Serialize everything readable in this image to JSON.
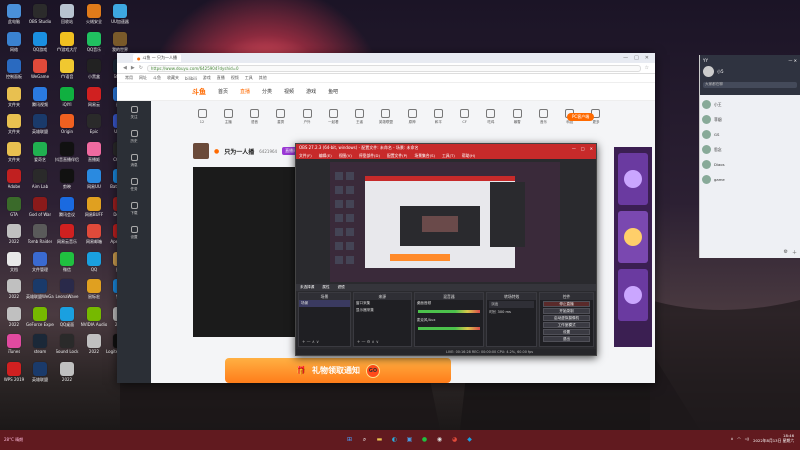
{
  "desktop": {
    "icons": [
      {
        "label": "此电脑",
        "color": "#4a90d9"
      },
      {
        "label": "OBS Studio",
        "color": "#2b2b2b"
      },
      {
        "label": "回收站",
        "color": "#b8c4d0"
      },
      {
        "label": "火绒安全",
        "color": "#e07b1a"
      },
      {
        "label": "UU加速器",
        "color": "#3da8e0"
      },
      {
        "label": "网络",
        "color": "#3a82d0"
      },
      {
        "label": "QQ游戏",
        "color": "#1a8fe0"
      },
      {
        "label": "YY游戏大厅",
        "color": "#f0c020"
      },
      {
        "label": "QQ音乐",
        "color": "#20c060"
      },
      {
        "label": "我的世界",
        "color": "#7a5a2a"
      },
      {
        "label": "控制面板",
        "color": "#2a6ac0"
      },
      {
        "label": "WeGame",
        "color": "#e04a3a"
      },
      {
        "label": "YY语音",
        "color": "#f0c830"
      },
      {
        "label": "小黑盒",
        "color": "#222222"
      },
      {
        "label": "Steam",
        "color": "#1b2838"
      },
      {
        "label": "文件夹",
        "color": "#e8c050"
      },
      {
        "label": "腾讯视频",
        "color": "#2a7ae0"
      },
      {
        "label": "iQIYI",
        "color": "#10b040"
      },
      {
        "label": "网易云",
        "color": "#d02020"
      },
      {
        "label": "迅雷",
        "color": "#2a7ae0"
      },
      {
        "label": "文件夹",
        "color": "#e8c050"
      },
      {
        "label": "英雄联盟",
        "color": "#1a3a6a"
      },
      {
        "label": "Origin",
        "color": "#f06020"
      },
      {
        "label": "Epic",
        "color": "#2a2a2a"
      },
      {
        "label": "Uplay",
        "color": "#3a5ad0"
      },
      {
        "label": "文件夹",
        "color": "#e8c050"
      },
      {
        "label": "爱奇艺",
        "color": "#20b050"
      },
      {
        "label": "抖音直播伴侣",
        "color": "#111111"
      },
      {
        "label": "直播姬",
        "color": "#f06aa0"
      },
      {
        "label": "CC直播",
        "color": "#2a2a2a"
      },
      {
        "label": "Adobe",
        "color": "#c02020"
      },
      {
        "label": "Aim Lab",
        "color": "#2a2a2a"
      },
      {
        "label": "剪映",
        "color": "#111111"
      },
      {
        "label": "网易UU",
        "color": "#2a8ae0"
      },
      {
        "label": "Battle.net",
        "color": "#1a8ae0"
      },
      {
        "label": "GTA",
        "color": "#3a6a2a"
      },
      {
        "label": "God of War",
        "color": "#8a1a1a"
      },
      {
        "label": "腾讯会议",
        "color": "#1a6ae0"
      },
      {
        "label": "网易BUFF",
        "color": "#e0a020"
      },
      {
        "label": "Dota 2",
        "color": "#a02020"
      },
      {
        "label": "2022",
        "color": "#c0c0c0"
      },
      {
        "label": "Tomb Raider",
        "color": "#5a5a5a"
      },
      {
        "label": "网易云音乐",
        "color": "#d02020"
      },
      {
        "label": "网易邮箱",
        "color": "#e04a3a"
      },
      {
        "label": "Apex 英雄",
        "color": "#c02020"
      },
      {
        "label": "文档",
        "color": "#e8e8e8"
      },
      {
        "label": "文件管理",
        "color": "#3a6ad0"
      },
      {
        "label": "微信",
        "color": "#20c040"
      },
      {
        "label": "QQ",
        "color": "#1aa0e0"
      },
      {
        "label": "图片",
        "color": "#d0a050"
      },
      {
        "label": "2022",
        "color": "#c0c0c0"
      },
      {
        "label": "英雄联盟WeGame",
        "color": "#1a3a6a"
      },
      {
        "label": "LeonaWave",
        "color": "#2a2a4a"
      },
      {
        "label": "鼠标宏",
        "color": "#e0a020"
      },
      {
        "label": "钉钉",
        "color": "#1a8ae0"
      },
      {
        "label": "2022",
        "color": "#c0c0c0"
      },
      {
        "label": "GeForce Experience",
        "color": "#76b900"
      },
      {
        "label": "QQ桌面",
        "color": "#1aa0e0"
      },
      {
        "label": "NVIDIA Audio",
        "color": "#76b900"
      },
      {
        "label": "2022",
        "color": "#c0c0c0"
      },
      {
        "label": "iTunes",
        "color": "#e04aa0"
      },
      {
        "label": "steam",
        "color": "#1b2838"
      },
      {
        "label": "Sound Lock",
        "color": "#2a2a2a"
      },
      {
        "label": "2022",
        "color": "#c0c0c0"
      },
      {
        "label": "Logitech G HUB",
        "color": "#111111"
      },
      {
        "label": "WPS 2019",
        "color": "#d02020"
      },
      {
        "label": "英雄联盟",
        "color": "#1a3a6a"
      },
      {
        "label": "2022",
        "color": "#c0c0c0"
      }
    ]
  },
  "browser": {
    "tab_title": "斗鱼 — 只为一人播",
    "url": "https://www.douyu.com/6425904?dyshid=0",
    "window_controls": [
      "—",
      "□",
      "✕"
    ],
    "bookmarks": [
      "常用",
      "网址",
      "斗鱼",
      "收藏夹",
      "bilibili",
      "游戏",
      "直播",
      "视频",
      "工具",
      "其他"
    ],
    "site": {
      "logo": "斗鱼",
      "nav": [
        "首页",
        "直播",
        "分类",
        "视频",
        "游戏",
        "鱼吧"
      ],
      "active_nav": "直播"
    },
    "rail": [
      "关注",
      "历史",
      "消息",
      "任务",
      "下载",
      "设置"
    ],
    "categories": [
      "12",
      "主播",
      "语音",
      "星秀",
      "户外",
      "一起看",
      "王者",
      "英雄联盟",
      "原神",
      "和平",
      "CF",
      "吃鸡",
      "暴雪",
      "音乐",
      "科技",
      "更多"
    ],
    "pc_button": "PC客户端",
    "streamer": {
      "title": "只为一人播",
      "room_id": "6421964",
      "name": "直播间"
    },
    "promo": {
      "text": "礼物领取通知",
      "go": "GO"
    }
  },
  "obs": {
    "title": "OBS 27.2.3 (64-bit, windows) - 配置文件: 未命名 - 场景: 未命名",
    "menu": [
      "文件(F)",
      "编辑(E)",
      "视图(V)",
      "停靠部件(D)",
      "配置文件(P)",
      "场景集合(S)",
      "工具(T)",
      "帮助(H)"
    ],
    "toolbar": [
      "未选择源",
      "属性",
      "滤镜"
    ],
    "docks": {
      "scenes": {
        "title": "场景",
        "items": [
          "场景"
        ]
      },
      "sources": {
        "title": "来源",
        "items": [
          "窗口采集",
          "显示器采集"
        ]
      },
      "mixer": {
        "title": "混音器",
        "items": [
          "桌面音频",
          "麦克风/Aux"
        ]
      },
      "transitions": {
        "title": "转场特效",
        "items": [
          "淡出",
          "时长 300 ms"
        ]
      },
      "controls": {
        "title": "控件",
        "buttons": [
          "停止直播",
          "开始录制",
          "启动虚拟摄像机",
          "工作室模式",
          "设置",
          "退出"
        ]
      }
    },
    "status": "LIVE: 00:16:28   REC: 00:00:00   CPU: 4.2%, 60.00 fps"
  },
  "chat": {
    "app": "YY",
    "username": "小5",
    "search_placeholder": "大家都在聊",
    "items": [
      "小王",
      "菲烟",
      "GS",
      "思念",
      "Diaos",
      "game"
    ]
  },
  "taskbar": {
    "weather": "28°C 晴朗",
    "center_icons": [
      {
        "name": "windows-icon",
        "glyph": "⊞",
        "color": "#4aa0ff"
      },
      {
        "name": "search-icon",
        "glyph": "⌕",
        "color": "#ffffff"
      },
      {
        "name": "file-explorer-icon",
        "glyph": "▬",
        "color": "#e8c050"
      },
      {
        "name": "edge-icon",
        "glyph": "◐",
        "color": "#2ab0e0"
      },
      {
        "name": "store-icon",
        "glyph": "▣",
        "color": "#4a9ae0"
      },
      {
        "name": "wechat-icon",
        "glyph": "●",
        "color": "#20c040"
      },
      {
        "name": "obs-icon",
        "glyph": "◉",
        "color": "#dddddd"
      },
      {
        "name": "chrome-icon",
        "glyph": "◕",
        "color": "#e04a3a"
      },
      {
        "name": "qq-icon",
        "glyph": "◆",
        "color": "#1aa0e0"
      }
    ],
    "clock_time": "18:46",
    "clock_date": "2022年8月13日 星期六"
  }
}
